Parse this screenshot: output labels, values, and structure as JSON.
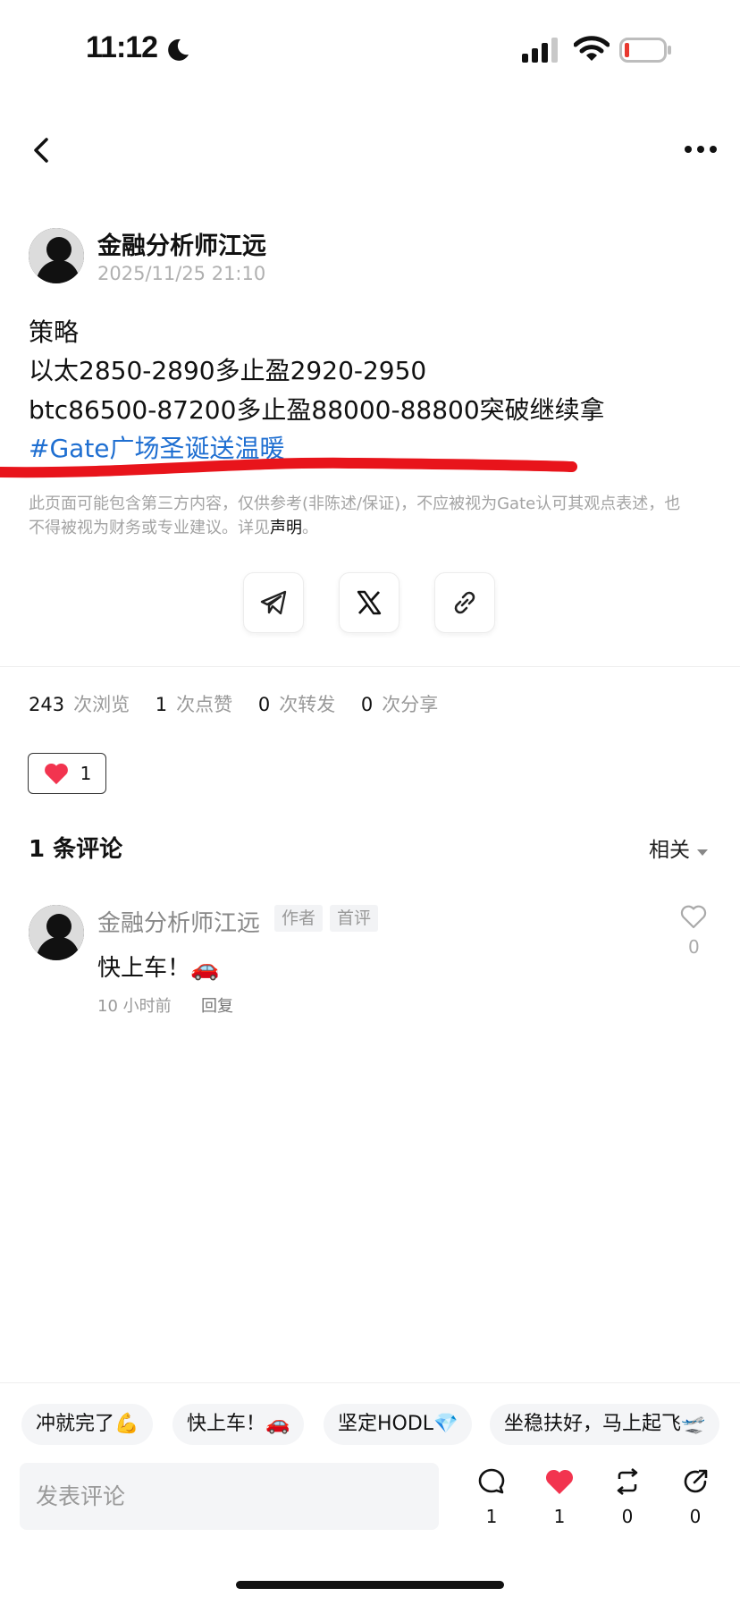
{
  "status_bar": {
    "time": "11:12"
  },
  "post": {
    "author": "金融分析师江远",
    "timestamp": "2025/11/25 21:10",
    "lines": [
      "策略",
      "以太2850-2890多止盈2920-2950",
      "btc86500-87200多止盈88000-88800突破继续拿"
    ],
    "hashtag": "#Gate广场圣诞送温暖",
    "disclaimer": "此页面可能包含第三方内容，仅供参考(非陈述/保证)，不应被视为Gate认可其观点表述，也不得被视为财务或专业建议。详见",
    "disclaimer_link": "声明",
    "disclaimer_end": "。"
  },
  "stats": {
    "views": "243",
    "views_label": "次浏览",
    "likes": "1",
    "likes_label": "次点赞",
    "reposts": "0",
    "reposts_label": "次转发",
    "shares": "0",
    "shares_label": "次分享"
  },
  "reaction": {
    "count": "1"
  },
  "comments": {
    "title": "1 条评论",
    "sort_label": "相关",
    "items": [
      {
        "author": "金融分析师江远",
        "tag_author": "作者",
        "tag_first": "首评",
        "text": "快上车！🚗",
        "time": "10 小时前",
        "reply": "回复",
        "likes": "0"
      }
    ]
  },
  "quick_replies": [
    "冲就完了💪",
    "快上车！🚗",
    "坚定HODL💎",
    "坐稳扶好，马上起飞🛫"
  ],
  "composer": {
    "placeholder": "发表评论"
  },
  "actions": {
    "comments": "1",
    "likes": "1",
    "reposts": "0",
    "shares": "0"
  },
  "colors": {
    "link": "#1f6fd1",
    "like_red": "#f2344f",
    "annotation_red": "#e8141b"
  },
  "icons": [
    "moon-icon",
    "signal-icon",
    "wifi-icon",
    "battery-icon",
    "back-icon",
    "more-icon",
    "telegram-icon",
    "x-icon",
    "link-icon",
    "heart-icon",
    "chevron-down-icon",
    "comment-icon",
    "repost-icon",
    "share-icon"
  ]
}
